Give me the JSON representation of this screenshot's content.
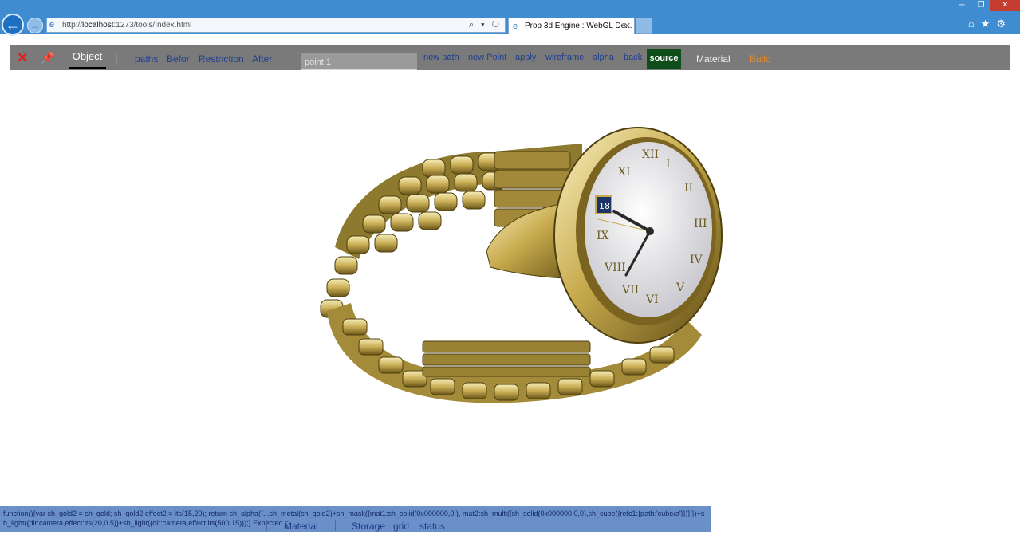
{
  "browser": {
    "url_prefix": "http://",
    "url_host": "localhost",
    "url_rest": ":1273/tools/Index.html",
    "address_controls": "⌕ ▾ ↻",
    "tab_title": "Prop 3d Engine : WebGL De...",
    "tab_close": "✕",
    "back_glyph": "←",
    "forward_glyph": "→",
    "win_min": "─",
    "win_max": "❐",
    "win_close": "✕",
    "tools_glyphs": "⌂★⚙"
  },
  "toolbar": {
    "close_glyph": "✕",
    "pin_glyph": "📌",
    "object_tab": "Object",
    "paths": "paths",
    "befor": "Befor",
    "restriction": "Restriction",
    "after": "After",
    "point_value": "point 1",
    "new_path": "new path",
    "new_point": "new Point",
    "apply": "apply",
    "wireframe": "wireframe",
    "alpha": "alpha",
    "back": "back",
    "source": "source",
    "material": "Material",
    "build": "Build"
  },
  "viewport": {
    "model": "gold wristwatch",
    "gold_light": "#f3e7a6",
    "gold_mid": "#bfa34a",
    "gold_dark": "#5a4a14",
    "dial": "#e9e9ec"
  },
  "console": {
    "code": "function(){var sh_gold2 = sh_gold; sh_gold2.effect2 = its(15,20); return sh_alpha({...sh_metal(sh_gold2)+sh_mask({mat1:sh_solid(0x000000,0,), mat2:sh_multi([sh_solid(0x000000,0,0),sh_cube({refc1:{path:'cube/a'}})] })+sh_light({dir:camera,effect:its(20,0.5)}+sh_light({dir:camera,effect:its(500,15)});} Expected ';'",
    "material": "Material",
    "storage": "Storage",
    "grid": "grid",
    "status": "status"
  }
}
